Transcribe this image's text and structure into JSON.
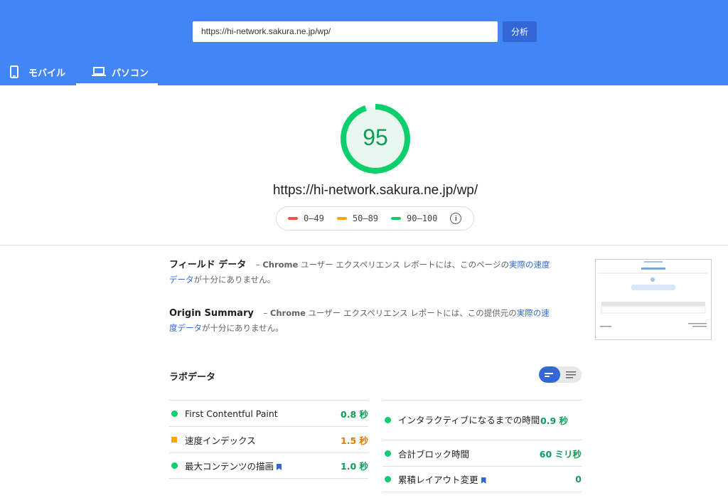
{
  "header": {
    "url_value": "https://hi-network.sakura.ne.jp/wp/",
    "analyze_label": "分析",
    "tabs": [
      {
        "label": "モバイル",
        "icon": "mobile-phone-icon"
      },
      {
        "label": "パソコン",
        "icon": "laptop-icon",
        "active": true
      }
    ],
    "color": "#4285f4"
  },
  "score": {
    "value": "95",
    "url": "https://hi-network.sakura.ne.jp/wp/",
    "fraction": 0.95,
    "color": "#0cce6b"
  },
  "legend": [
    {
      "label": "0–49",
      "color": "#ff4e42"
    },
    {
      "label": "50–89",
      "color": "#ffa400"
    },
    {
      "label": "90–100",
      "color": "#0cce6b"
    }
  ],
  "field": {
    "title": "フィールド データ",
    "dash": " – ",
    "chrome": "Chrome",
    "text": " ユーザー エクスペリエンス レポートには、このページの",
    "link": "実際の速度データ",
    "tail": "が十分にありません。"
  },
  "origin": {
    "title": "Origin Summary",
    "dash": " – ",
    "chrome": "Chrome",
    "text": " ユーザー エクスペリエンス レポートには、この提供元の",
    "link": "実際の速度データ",
    "tail": "が十分にありません。"
  },
  "lab": {
    "title": "ラボデータ",
    "left": [
      {
        "label": "First Contentful Paint",
        "value": "0.8 秒",
        "status": "good"
      },
      {
        "label": "速度インデックス",
        "value": "1.5 秒",
        "status": "average"
      },
      {
        "label": "最大コンテンツの描画",
        "value": "1.0 秒",
        "status": "good",
        "flag": true
      }
    ],
    "right": [
      {
        "label": "インタラクティブになるまでの時間",
        "value": "0.9 秒",
        "status": "good"
      },
      {
        "label": "合計ブロック時間",
        "value": "60 ミリ秒",
        "status": "good"
      },
      {
        "label": "累積レイアウト変更",
        "value": "0",
        "status": "good",
        "flag": true
      }
    ]
  },
  "colors": {
    "good": "#0cce6b",
    "good_text": "#0c9d58",
    "average": "#ffa400",
    "average_text": "#e67700",
    "link": "#3367d6"
  }
}
